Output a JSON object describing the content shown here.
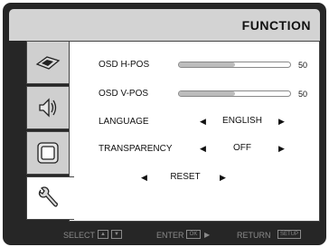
{
  "header": {
    "title": "FUNCTION"
  },
  "tabs": [
    {
      "icon": "picture-icon"
    },
    {
      "icon": "audio-icon"
    },
    {
      "icon": "screen-icon"
    },
    {
      "icon": "wrench-icon",
      "active": true
    }
  ],
  "settings": {
    "osd_hpos": {
      "label": "OSD H-POS",
      "value": "50",
      "level": 0.5
    },
    "osd_vpos": {
      "label": "OSD V-POS",
      "value": "50",
      "level": 0.5
    },
    "language": {
      "label": "LANGUAGE",
      "value": "ENGLISH"
    },
    "transparency": {
      "label": "TRANSPARENCY",
      "value": "OFF"
    },
    "reset": {
      "label": "RESET"
    }
  },
  "footer": {
    "select": "SELECT",
    "enter": "ENTER",
    "ok_key": "OK",
    "return": "RETURN",
    "setup_key": "SETUP"
  }
}
